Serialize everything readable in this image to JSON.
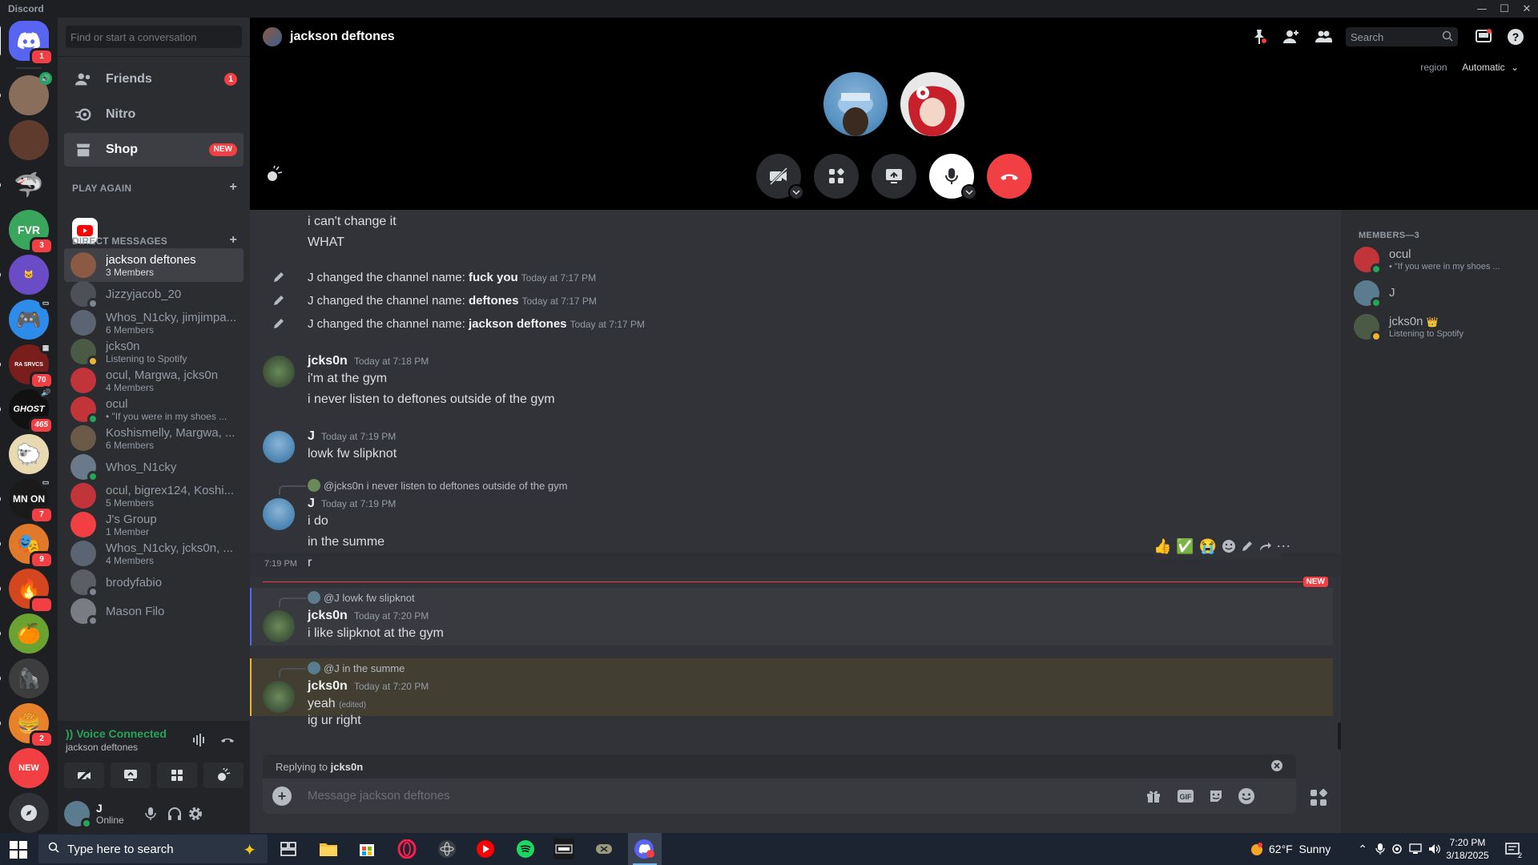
{
  "window": {
    "title": "Discord",
    "controls": [
      "minimize",
      "maximize",
      "close"
    ]
  },
  "server_rail": {
    "home_badge": "1",
    "servers": [
      {
        "name": "server-2",
        "badge": "",
        "color": "#8a6e5c"
      },
      {
        "name": "server-3",
        "badge": "",
        "color": "#5e3b2c"
      },
      {
        "name": "server-4",
        "badge": "",
        "color": "#3a8fd8"
      },
      {
        "name": "FVR",
        "badge": "3",
        "color": "#3aa55d"
      },
      {
        "name": "server-6",
        "badge": "",
        "color": "#6a4cc7"
      },
      {
        "name": "server-7",
        "badge": "",
        "color": "#2d8bea"
      },
      {
        "name": "RA SRVCS",
        "badge": "70",
        "color": "#7a1d1d"
      },
      {
        "name": "GHOST",
        "badge": "465",
        "color": "#111111"
      },
      {
        "name": "server-10",
        "badge": "",
        "color": "#e8d9b0"
      },
      {
        "name": "MN ON",
        "badge": "7",
        "color": "#1a1a1a"
      },
      {
        "name": "server-12",
        "badge": "11",
        "color": "#e07a2a"
      },
      {
        "name": "server-13",
        "badge": "9",
        "color": "#d4461e"
      },
      {
        "name": "server-14",
        "badge": "",
        "color": "#6ba333"
      },
      {
        "name": "server-15",
        "badge": "",
        "color": "#3d3d3d"
      },
      {
        "name": "server-16",
        "badge": "2",
        "color": "#e8822a"
      },
      {
        "name": "NEW",
        "badge": "",
        "color": "#f23f43"
      }
    ]
  },
  "sidebar": {
    "search_placeholder": "Find or start a conversation",
    "nav": [
      {
        "label": "Friends",
        "badge": "1"
      },
      {
        "label": "Nitro",
        "badge": ""
      },
      {
        "label": "Shop",
        "badge": "NEW"
      }
    ],
    "play_again_header": "PLAY AGAIN",
    "dm_header": "DIRECT MESSAGES",
    "dms": [
      {
        "name": "jackson deftones",
        "sub": "3 Members",
        "color": "#8a5a44",
        "status": ""
      },
      {
        "name": "Jizzyjacob_20",
        "sub": "",
        "color": "#4e5058",
        "status": "offline"
      },
      {
        "name": "Whos_N1cky, jimjimpa...",
        "sub": "6 Members",
        "color": "#5a6472",
        "status": ""
      },
      {
        "name": "jcks0n",
        "sub": "Listening to Spotify",
        "color": "#4a5a44",
        "status": "idle"
      },
      {
        "name": "ocul, Margwa, jcks0n",
        "sub": "4 Members",
        "color": "#c0343a",
        "status": ""
      },
      {
        "name": "ocul",
        "sub": "• \"If you were in my shoes ...",
        "color": "#c0343a",
        "status": "online"
      },
      {
        "name": "Koshismelly, Margwa, ...",
        "sub": "6 Members",
        "color": "#6b5a48",
        "status": ""
      },
      {
        "name": "Whos_N1cky",
        "sub": "",
        "color": "#6b7a8a",
        "status": "online"
      },
      {
        "name": "ocul, bigrex124, Koshi...",
        "sub": "5 Members",
        "color": "#c0343a",
        "status": ""
      },
      {
        "name": "J's Group",
        "sub": "1 Member",
        "color": "#f23f43",
        "status": ""
      },
      {
        "name": "Whos_N1cky, jcks0n, ...",
        "sub": "4 Members",
        "color": "#5a6472",
        "status": ""
      },
      {
        "name": "brodyfabio",
        "sub": "",
        "color": "#5c5e66",
        "status": "offline"
      },
      {
        "name": "Mason Filo",
        "sub": "",
        "color": "#7a7c84",
        "status": "offline"
      }
    ],
    "voice": {
      "title": "Voice Connected",
      "channel": "jackson deftones"
    },
    "user": {
      "name": "J",
      "status": "Online"
    }
  },
  "header": {
    "channel_name": "jackson deftones",
    "search_placeholder": "Search",
    "region_label": "region",
    "region_value": "Automatic"
  },
  "chat": {
    "lines_top": [
      "i can't change it",
      "WHAT"
    ],
    "system": [
      {
        "prefix": "J changed the channel name: ",
        "name": "fuck you",
        "time": "Today at 7:17 PM"
      },
      {
        "prefix": "J changed the channel name: ",
        "name": "deftones",
        "time": "Today at 7:17 PM"
      },
      {
        "prefix": "J changed the channel name: ",
        "name": "jackson deftones",
        "time": "Today at 7:17 PM"
      }
    ],
    "messages": [
      {
        "author": "jcks0n",
        "time": "Today at 7:18 PM",
        "lines": [
          "i'm at the gym",
          "i never listen to deftones outside of the gym"
        ]
      },
      {
        "author": "J",
        "time": "Today at 7:19 PM",
        "lines": [
          "lowk fw slipknot"
        ]
      },
      {
        "reply_to": "@jcks0n",
        "reply_text": "i never listen to deftones outside of the gym",
        "author": "J",
        "time": "Today at 7:19 PM",
        "lines": [
          "i do",
          "in the summe"
        ]
      },
      {
        "hover_time": "7:19 PM",
        "lines": [
          "r"
        ]
      },
      {
        "reply_to": "@J",
        "reply_text": "lowk fw slipknot",
        "author": "jcks0n",
        "time": "Today at 7:20 PM",
        "lines": [
          "i like slipknot at the gym"
        ]
      },
      {
        "reply_to": "@J",
        "reply_text": "in the summe",
        "author": "jcks0n",
        "time": "Today at 7:20 PM",
        "lines": [
          "yeah",
          "ig ur right"
        ],
        "edited": "(edited)"
      }
    ],
    "new_label": "NEW",
    "reactions": [
      "👍",
      "✅",
      "😭"
    ]
  },
  "composer": {
    "replying_prefix": "Replying to ",
    "replying_name": "jcks0n",
    "placeholder": "Message jackson deftones"
  },
  "members": {
    "header": "MEMBERS—3",
    "list": [
      {
        "name": "ocul",
        "sub": "• \"If you were in my shoes ...",
        "color": "#c0343a",
        "status": "online"
      },
      {
        "name": "J",
        "sub": "",
        "color": "#5a7c8e",
        "status": "online"
      },
      {
        "name": "jcks0n",
        "sub": "Listening to Spotify",
        "color": "#4a5a44",
        "status": "idle",
        "owner": "👑"
      }
    ]
  },
  "taskbar": {
    "search_placeholder": "Type here to search",
    "weather": "62°F  Sunny",
    "time": "7:20 PM",
    "date": "3/18/2025",
    "notif_count": "2"
  },
  "colors": {
    "online": "#23a55a",
    "idle": "#f0b232",
    "offline": "#80848e",
    "blurple": "#5865f2",
    "red": "#f23f43"
  }
}
